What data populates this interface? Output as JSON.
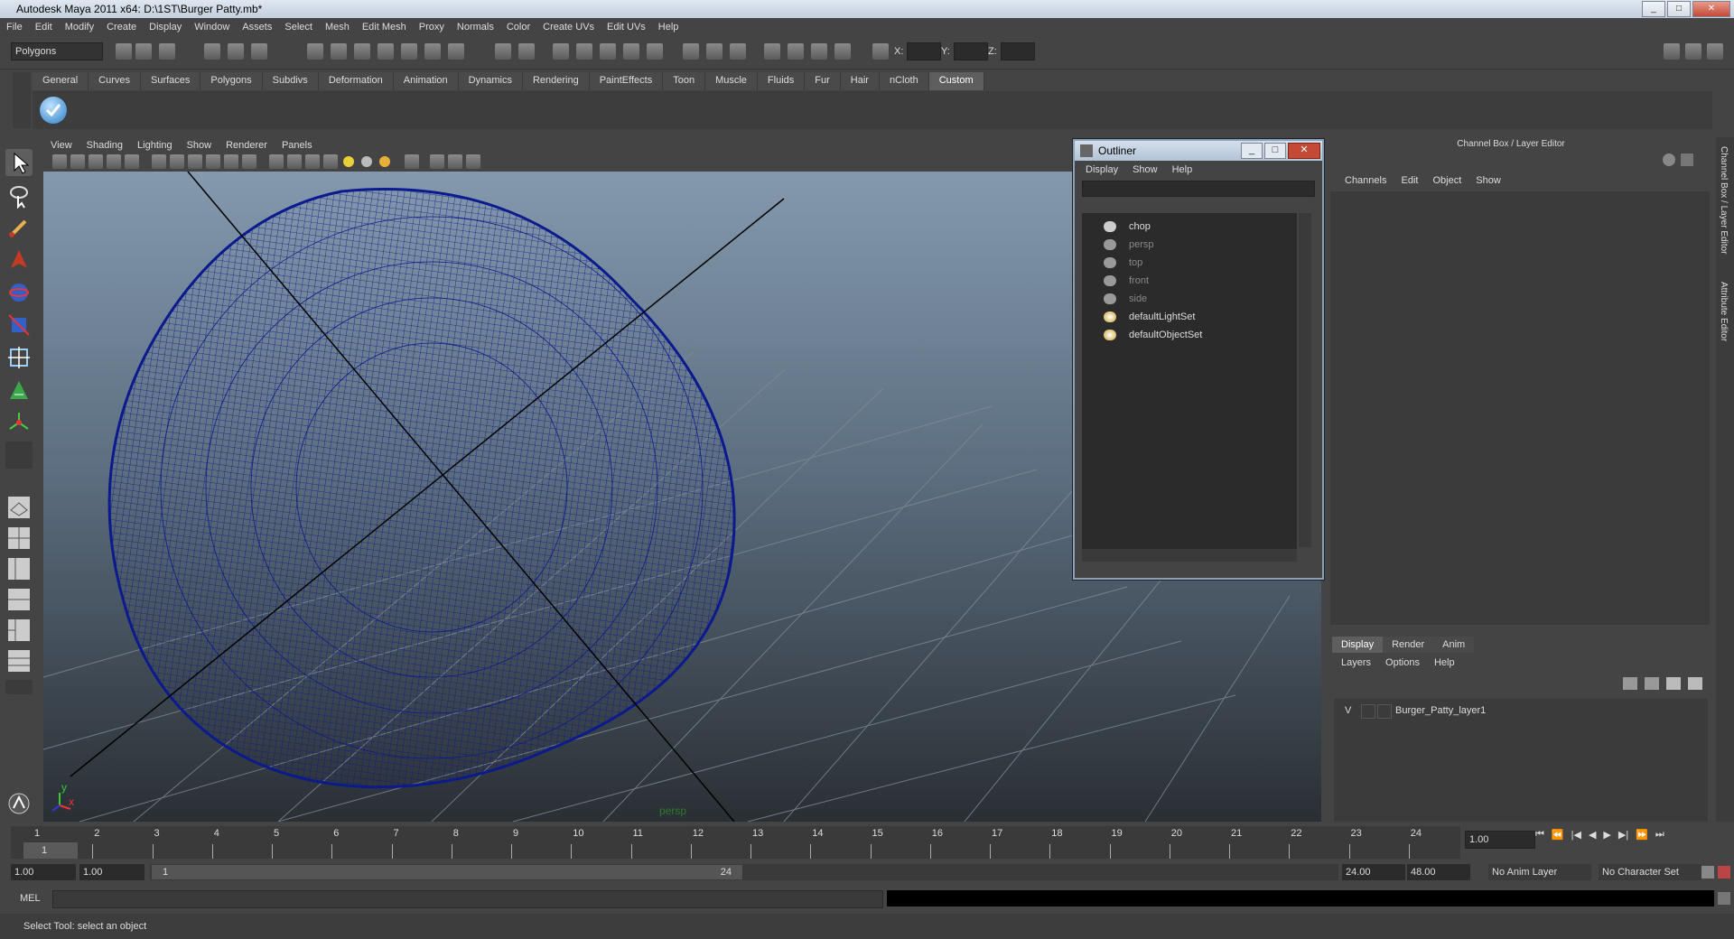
{
  "window": {
    "title": "Autodesk Maya 2011 x64: D:\\1ST\\Burger Patty.mb*"
  },
  "menubar": [
    "File",
    "Edit",
    "Modify",
    "Create",
    "Display",
    "Window",
    "Assets",
    "Select",
    "Mesh",
    "Edit Mesh",
    "Proxy",
    "Normals",
    "Color",
    "Create UVs",
    "Edit UVs",
    "Help"
  ],
  "status": {
    "mode": "Polygons",
    "x_label": "X:",
    "y_label": "Y:",
    "z_label": "Z:"
  },
  "shelf_tabs": [
    "General",
    "Curves",
    "Surfaces",
    "Polygons",
    "Subdivs",
    "Deformation",
    "Animation",
    "Dynamics",
    "Rendering",
    "PaintEffects",
    "Toon",
    "Muscle",
    "Fluids",
    "Fur",
    "Hair",
    "nCloth",
    "Custom"
  ],
  "shelf_active": "Custom",
  "viewport": {
    "menu": [
      "View",
      "Shading",
      "Lighting",
      "Show",
      "Renderer",
      "Panels"
    ],
    "camera_label": "persp",
    "axis_y": "y",
    "axis_x": "x",
    "mesh_color": "#0b1a8c"
  },
  "outliner": {
    "title": "Outliner",
    "menu": [
      "Display",
      "Show",
      "Help"
    ],
    "items": [
      {
        "name": "chop",
        "dim": false
      },
      {
        "name": "persp",
        "dim": true
      },
      {
        "name": "top",
        "dim": true
      },
      {
        "name": "front",
        "dim": true
      },
      {
        "name": "side",
        "dim": true
      },
      {
        "name": "defaultLightSet",
        "dim": false
      },
      {
        "name": "defaultObjectSet",
        "dim": false
      }
    ]
  },
  "channel_box": {
    "title": "Channel Box / Layer Editor",
    "menu": [
      "Channels",
      "Edit",
      "Object",
      "Show"
    ]
  },
  "layer_editor": {
    "tabs": [
      "Display",
      "Render",
      "Anim"
    ],
    "menu": [
      "Layers",
      "Options",
      "Help"
    ],
    "layer": {
      "visible": "V",
      "name": "Burger_Patty_layer1"
    }
  },
  "side_tabs": [
    "Channel Box / Layer Editor",
    "Attribute Editor"
  ],
  "timeslider": {
    "ticks": [
      "1",
      "2",
      "3",
      "4",
      "5",
      "6",
      "7",
      "8",
      "9",
      "10",
      "11",
      "12",
      "13",
      "14",
      "15",
      "16",
      "17",
      "18",
      "19",
      "20",
      "21",
      "22",
      "23",
      "24"
    ],
    "current_frame": "1",
    "current_field": "1.00"
  },
  "range": {
    "start": "1.00",
    "playback_start": "1.00",
    "range_start_label": "1",
    "range_end_label": "24",
    "playback_end": "24.00",
    "end": "48.00",
    "anim_layer": "No Anim Layer",
    "character_set": "No Character Set"
  },
  "cmdline": {
    "label": "MEL"
  },
  "helpline": {
    "text": "Select Tool: select an object"
  }
}
